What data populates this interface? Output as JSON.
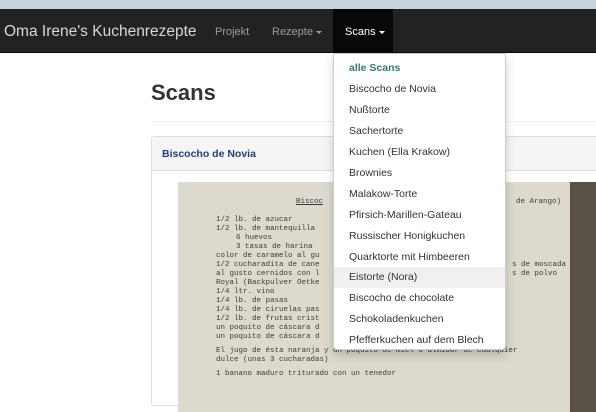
{
  "navbar": {
    "brand": "Oma Irene's Kuchenrezepte",
    "items": [
      {
        "label": "Projekt",
        "dropdown": false
      },
      {
        "label": "Rezepte",
        "dropdown": true
      },
      {
        "label": "Scans",
        "dropdown": true,
        "active": true
      }
    ]
  },
  "dropdown": {
    "items": [
      "alle Scans",
      "Biscocho de Novia",
      "Nußtorte",
      "Sachertorte",
      "Kuchen (Ella Krakow)",
      "Brownies",
      "Malakow-Torte",
      "Pfirsich-Marillen-Gateau",
      "Russischer Honigkuchen",
      "Quarktorte mit Himbeeren",
      "Eistorte (Nora)",
      "Biscocho de chocolate",
      "Schokoladenkuchen",
      "Pfefferkuchen auf dem Blech"
    ],
    "hovered": "Eistorte (Nora)"
  },
  "page": {
    "title": "Scans"
  },
  "panel": {
    "title": "Biscocho de Novia"
  },
  "scan": {
    "lines": [
      "Biscoc",
      "de Arango)",
      "1/2 lb. de azucar",
      "1/2 lb. de mantequilla",
      "6 huevos",
      "3 tasas de harina",
      "color de caramelo al gu",
      "1/2 cucharadita de cane",
      "s de moscada",
      "al gusto cernidos con l",
      "s de polvo",
      "Royal (Backpulver Oetke",
      "1/4 ltr. vino",
      "1/4 lb. de pasas",
      "1/4 lb. de ciruelas pas",
      "1/2 lb. de frutas crist",
      "un poquito de cáscara d",
      "un poquito de cáscara d",
      "El jugo de ésta naranja y un poquito de miel o almibar de cualquier",
      "dulce (unas 3 cucharadas)",
      "1 banano maduro triturado con un tenedor"
    ]
  },
  "colors": {
    "navbar_bg": "#222222",
    "active_bg": "#080808",
    "panel_title": "#1f3f7a",
    "dropdown_header": "#2e7d6e"
  }
}
